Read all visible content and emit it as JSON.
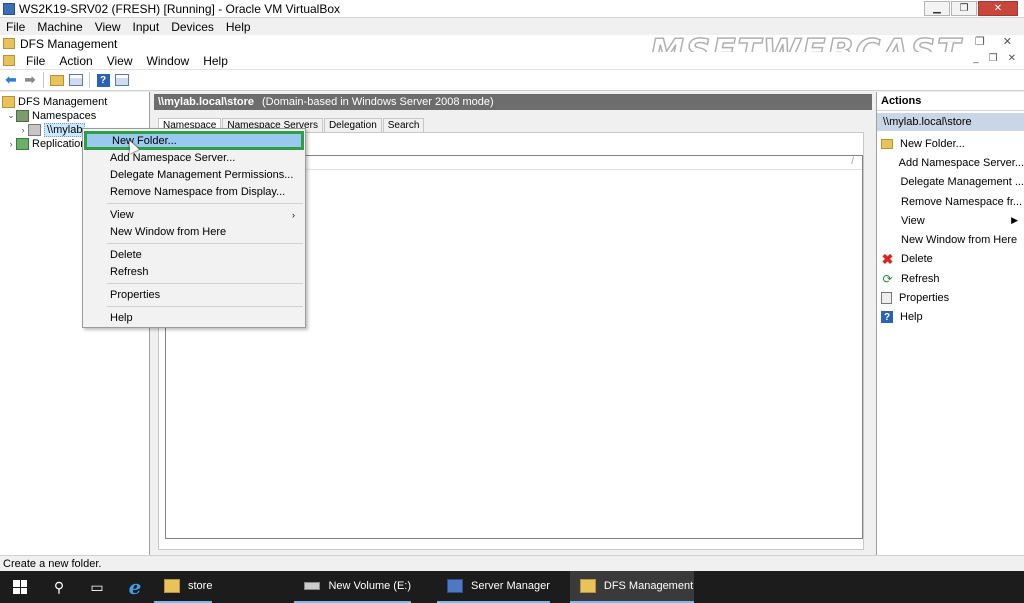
{
  "vbox": {
    "title": "WS2K19-SRV02 (FRESH) [Running] - Oracle VM VirtualBox",
    "menu": [
      "File",
      "Machine",
      "View",
      "Input",
      "Devices",
      "Help"
    ]
  },
  "mmc": {
    "title": "DFS Management",
    "menu": [
      "File",
      "Action",
      "View",
      "Window",
      "Help"
    ],
    "watermark": "MSFTWEBCAST"
  },
  "tree": {
    "root": "DFS Management",
    "namespaces": "Namespaces",
    "store_node": "\\\\mylab",
    "replication": "Replication"
  },
  "center": {
    "header_path": "\\\\mylab.local\\store",
    "header_desc": "(Domain-based in Windows Server 2008 mode)",
    "tabs": [
      "Namespace",
      "Namespace Servers",
      "Delegation",
      "Search"
    ],
    "active_tab": "Namespace",
    "list_column_marker": "/"
  },
  "context_menu": {
    "items": {
      "new_folder": "New Folder...",
      "add_ns_server": "Add Namespace Server...",
      "delegate": "Delegate Management Permissions...",
      "remove_ns": "Remove Namespace from Display...",
      "view": "View",
      "new_window": "New Window from Here",
      "delete": "Delete",
      "refresh": "Refresh",
      "properties": "Properties",
      "help": "Help"
    },
    "highlighted": "New Folder..."
  },
  "actions": {
    "title": "Actions",
    "subheader": "\\\\mylab.local\\store",
    "items": {
      "new_folder": "New Folder...",
      "add_ns_server": "Add Namespace Server...",
      "delegate": "Delegate Management ...",
      "remove_ns": "Remove Namespace fr...",
      "view": "View",
      "new_window": "New Window from Here",
      "delete": "Delete",
      "refresh": "Refresh",
      "properties": "Properties",
      "help": "Help"
    }
  },
  "status": {
    "text": "Create a new folder."
  },
  "taskbar": {
    "apps": {
      "store": "store",
      "new_volume": "New Volume (E:)",
      "server_manager": "Server Manager",
      "dfs_management": "DFS Management"
    },
    "active_app": "DFS Management"
  },
  "colors": {
    "highlight_border": "#2ea043",
    "selection": "#99c9ef",
    "header_bar": "#6d6d6d",
    "taskbar": "#1c1c1c"
  }
}
